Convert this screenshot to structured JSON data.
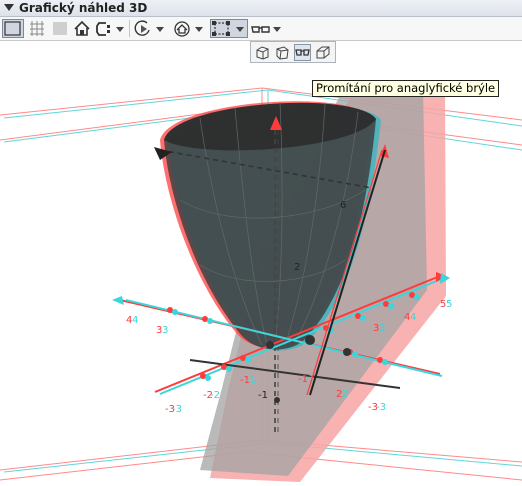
{
  "window": {
    "title": "Grafický náhled 3D"
  },
  "toolbar": {
    "buttons": [
      "show-axes-icon",
      "show-grid-icon",
      "shade-icon",
      "home-icon",
      "clipping-icon",
      "rotate-icon",
      "view-direction-icon",
      "box-icon",
      "glasses-icon"
    ]
  },
  "projection_menu": {
    "options": [
      "orthographic",
      "perspective",
      "anaglyph",
      "oblique"
    ],
    "selected": "anaglyph"
  },
  "tooltip": {
    "text": "Promítání pro anaglyfické brýle"
  },
  "axes": {
    "x_ticks": [
      {
        "red": "-3",
        "cyan": "-3"
      },
      {
        "red": "-2",
        "cyan": "-2"
      },
      {
        "red": "-1",
        "cyan": "-1"
      }
    ],
    "y_ticks": [
      {
        "red": "4",
        "cyan": "4"
      },
      {
        "red": "3",
        "cyan": "3"
      },
      {
        "red": "5",
        "cyan": "5"
      },
      {
        "red": "4",
        "cyan": "4"
      },
      {
        "red": "3",
        "cyan": "3"
      },
      {
        "red": "2",
        "cyan": "2"
      },
      {
        "red": "-1",
        "cyan": "-1"
      },
      {
        "red": "-3",
        "cyan": "-3"
      }
    ],
    "z_ticks": [
      {
        "label": "-1"
      },
      {
        "label": "2"
      },
      {
        "label": "6"
      }
    ]
  },
  "colors": {
    "anaglyph_red": "#ff3b3b",
    "anaglyph_cyan": "#3ad6dc",
    "surface_dark": "#3c3c3c",
    "plane_pink": "#f7a4a4",
    "plane_grey": "#9e9e9e"
  }
}
